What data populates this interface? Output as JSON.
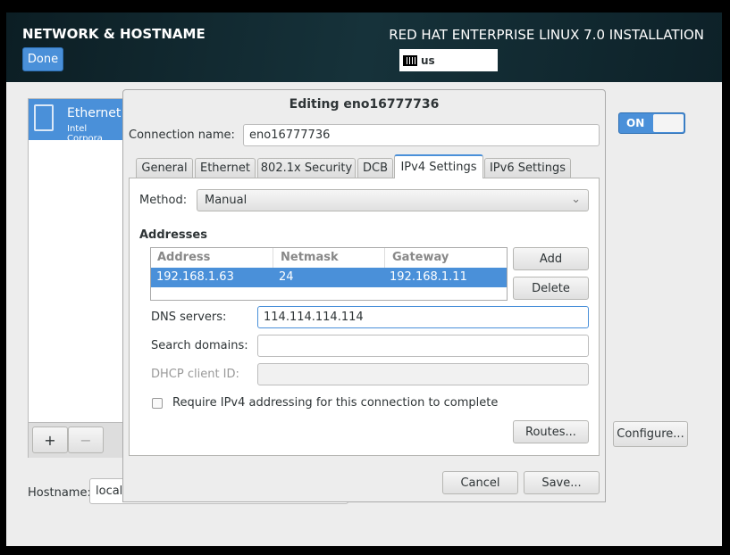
{
  "header": {
    "title": "NETWORK & HOSTNAME",
    "done": "Done",
    "product": "RED HAT ENTERPRISE LINUX 7.0 INSTALLATION",
    "keyboard": "us"
  },
  "device": {
    "name": "Ethernet",
    "vendor": "Intel Corpora",
    "toggle": "ON",
    "add": "+",
    "remove": "−",
    "configure": "Configure..."
  },
  "hostname": {
    "label": "Hostname:",
    "value": "locall"
  },
  "dialog": {
    "title": "Editing eno16777736",
    "conn_label": "Connection name:",
    "conn_value": "eno16777736",
    "tabs": [
      "General",
      "Ethernet",
      "802.1x Security",
      "DCB",
      "IPv4 Settings",
      "IPv6 Settings"
    ],
    "method_label": "Method:",
    "method_value": "Manual",
    "addresses_label": "Addresses",
    "columns": [
      "Address",
      "Netmask",
      "Gateway"
    ],
    "rows": [
      [
        "192.168.1.63",
        "24",
        "192.168.1.11"
      ]
    ],
    "add": "Add",
    "delete": "Delete",
    "dns_label": "DNS servers:",
    "dns_value": "114.114.114.114",
    "search_label": "Search domains:",
    "search_value": "",
    "dhcp_label": "DHCP client ID:",
    "dhcp_value": "",
    "require_label": "Require IPv4 addressing for this connection to complete",
    "routes": "Routes...",
    "cancel": "Cancel",
    "save": "Save..."
  },
  "colors": {
    "accent": "#4a90d9"
  }
}
